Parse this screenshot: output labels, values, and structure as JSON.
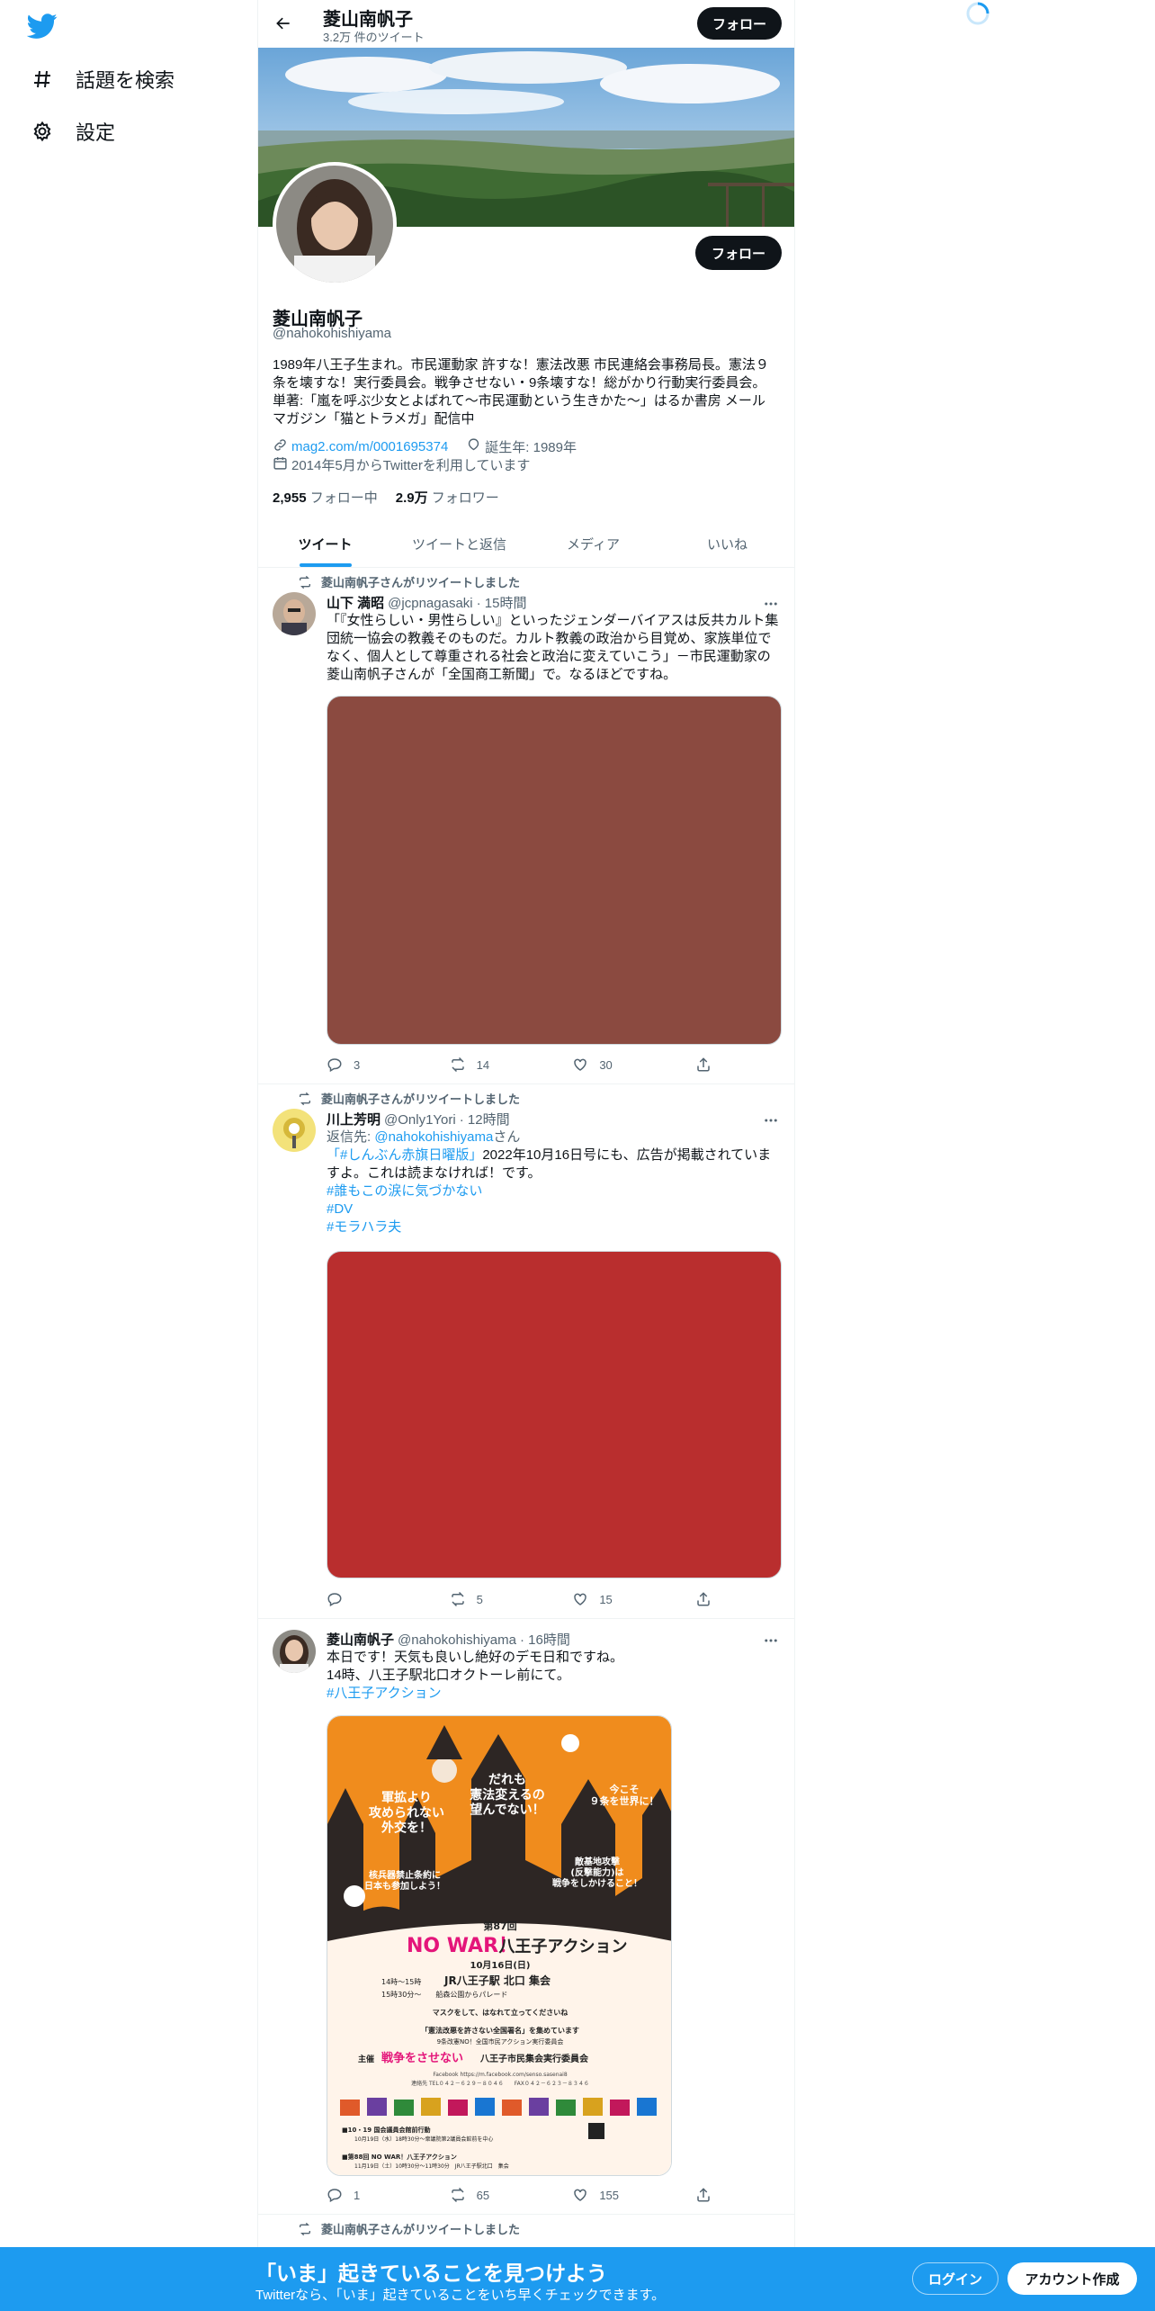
{
  "nav": {
    "logo_icon": "twitter-bird-icon",
    "explore_label": "話題を検索",
    "settings_label": "設定"
  },
  "header": {
    "title": "菱山南帆子",
    "tweet_count": "3.2万 件のツイート",
    "follow_label": "フォロー"
  },
  "profile": {
    "follow_label": "フォロー",
    "name": "菱山南帆子",
    "handle": "@nahokohishiyama",
    "bio": "1989年八王子生まれ。市民運動家 許すな！憲法改悪 市民連絡会事務局長。憲法９条を壊すな！実行委員会。戦争させない・9条壊すな！総がかり行動実行委員会。単著:「嵐を呼ぶ少女とよばれて〜市民運動という生きかた〜」はるか書房 メールマガジン「猫とトラメガ」配信中",
    "link": "mag2.com/m/0001695374",
    "birth": "誕生年: 1989年",
    "joined": "2014年5月からTwitterを利用しています",
    "following_count": "2,955",
    "following_label": "フォロー中",
    "followers_count": "2.9万",
    "followers_label": "フォロワー"
  },
  "tabs": [
    "ツイート",
    "ツイートと返信",
    "メディア",
    "いいね"
  ],
  "tweets": [
    {
      "rt_label": "菱山南帆子さんがリツイートしました",
      "name": "山下 満昭",
      "handle": "@jcpnagasaki",
      "time": "· 15時間",
      "text": "「『女性らしい・男性らしい』といったジェンダーバイアスは反共カルト集団統一協会の教義そのものだ。カルト教義の政治から目覚め、家族単位でなく、個人として尊重される社会と政治に変えていこう」－市民運動家の菱山南帆子さんが「全国商工新聞」で。なるほどですね。",
      "media_color": "#8b4a40",
      "reply": "3",
      "retweet": "14",
      "like": "30"
    },
    {
      "rt_label": "菱山南帆子さんがリツイートしました",
      "name": "川上芳明",
      "handle": "@Only1Yori",
      "time": "· 12時間",
      "reply_prefix": "返信先: ",
      "reply_to": "@nahokohishiyama",
      "reply_suffix": "さん",
      "hashtag_lead": "「#しんぶん赤旗日曜版」",
      "text": "2022年10月16日号にも、広告が掲載されていますよ。これは読まなければ！です。",
      "tags": [
        "#誰もこの涙に気づかない",
        "#DV",
        "#モラハラ夫"
      ],
      "media_color": "#b92e2e",
      "reply": "",
      "retweet": "5",
      "like": "15"
    },
    {
      "name": "菱山南帆子",
      "handle": "@nahokohishiyama",
      "time": "· 16時間",
      "line1": "本日です！天気も良いし絶好のデモ日和ですね。",
      "line2": "14時、八王子駅北口オクトーレ前にて。",
      "tag": "#八王子アクション",
      "poster": {
        "b1": "軍拡より\n攻められない\n外交を！",
        "b2": "だれも\n憲法変えるの\n望んでない！",
        "b3": "今こそ\n９条を世界に！",
        "b4": "核兵器禁止条約に\n日本も参加しよう！",
        "b5": "敵基地攻撃\n(反撃能力)は\n戦争をしかけること！",
        "round": "第87回",
        "headline_a": "NO WAR！",
        "headline_b": "八王子アクション",
        "date": "10月16日(日)",
        "time1": "14時〜15時",
        "place": "JR八王子駅 北口 集会",
        "time2": "15時30分〜　　船森公園からパレード",
        "mask": "マスクをして、はなれて立ってくださいね",
        "petition": "「憲法改悪を許さない全国署名」を集めています",
        "org_sub": "9条改憲NO！全国市民アクション実行委員会",
        "host_label": "主催",
        "host_a": "戦争をさせない",
        "host_b": "八王子市民集会実行委員会",
        "fb": "Facebook https://m.facebook.com/senso.sasenai8",
        "tel": "連絡先 TEL０４２－６２９－８０４６　　FAX０４２－６２３－８３４６",
        "event1": "■10・19 国会議員会館前行動",
        "event1_time": "10月19日（水）18時30分〜衆議院第2議員会館前を中心",
        "event2": "■第88回 NO WAR！八王子アクション",
        "event2_time": "11月19日（土）10時30分〜11時30分　JR八王子駅北口　集会"
      },
      "reply": "1",
      "retweet": "65",
      "like": "155"
    },
    {
      "rt_label": "菱山南帆子さんがリツイートしました"
    }
  ],
  "bottom": {
    "title": "「いま」起きていることを見つけよう",
    "sub": "Twitterなら、「いま」起きていることをいち早くチェックできます。",
    "login": "ログイン",
    "signup": "アカウント作成"
  },
  "colors": {
    "accent": "#1d9bf0",
    "text": "#0f1419",
    "muted": "#536471"
  }
}
